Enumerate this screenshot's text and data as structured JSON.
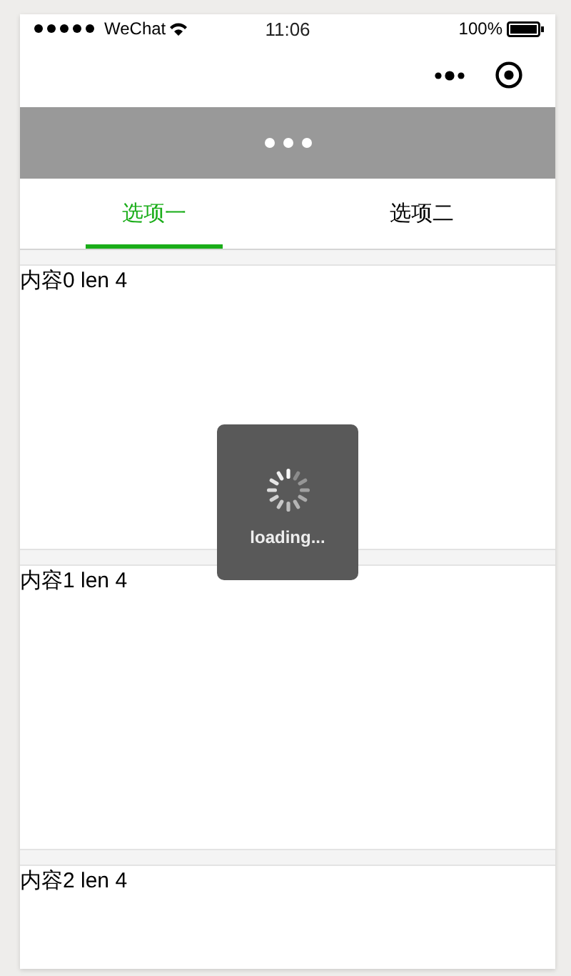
{
  "status_bar": {
    "carrier": "WeChat",
    "time": "11:06",
    "battery": "100%"
  },
  "tabs": [
    {
      "label": "选项一",
      "selected": true
    },
    {
      "label": "选项二",
      "selected": false
    }
  ],
  "items": [
    {
      "text": "内容0 len 4"
    },
    {
      "text": "内容1 len 4"
    },
    {
      "text": "内容2 len 4"
    }
  ],
  "toast": {
    "text": "loading..."
  }
}
